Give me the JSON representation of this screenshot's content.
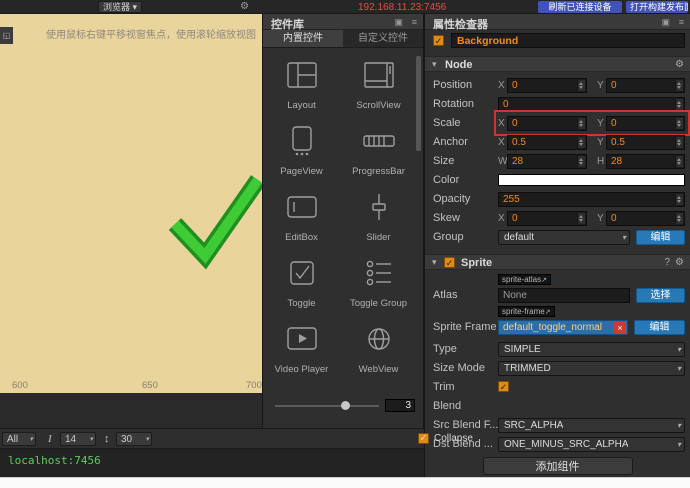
{
  "colors": {
    "accent_orange": "#f78a1d",
    "button_blue": "#2779b8",
    "annotation_red": "#d0342c",
    "check_green": "#3ecb35",
    "console_green": "#58d058",
    "url_red": "#e0513f"
  },
  "icons": {
    "gear": "⚙",
    "menu": "≡",
    "dock": "▣",
    "caret": "▾",
    "check": "✓",
    "close": "×",
    "help": "?",
    "font_size": "I",
    "line_height": "↕",
    "corner": "◱",
    "goto": "↗"
  },
  "toolbar": {
    "device_dropdown": "浏览器",
    "url": "192.168.11.23:7456",
    "refresh_button": "刷新已连接设备",
    "build_button": "打开构建发布面板"
  },
  "scene": {
    "hint": "使用鼠标右键平移视窗焦点，使用滚轮缩放视图",
    "ruler": [
      "600",
      "650",
      "700"
    ]
  },
  "widgets": {
    "title": "控件库",
    "tabs": [
      {
        "label": "内置控件"
      },
      {
        "label": "自定义控件"
      }
    ],
    "items": [
      {
        "label": "Layout"
      },
      {
        "label": "ScrollView"
      },
      {
        "label": "PageView"
      },
      {
        "label": "ProgressBar"
      },
      {
        "label": "EditBox"
      },
      {
        "label": "Slider"
      },
      {
        "label": "Toggle"
      },
      {
        "label": "Toggle Group"
      },
      {
        "label": "Video Player"
      },
      {
        "label": "WebView"
      }
    ],
    "zoom_value": "3"
  },
  "inspector": {
    "title": "属性检查器",
    "node_name": "Background",
    "node_section": "Node",
    "sprite_section": "Sprite",
    "axis": {
      "x": "X",
      "y": "Y",
      "w": "W",
      "h": "H"
    },
    "position": {
      "label": "Position",
      "x": "0",
      "y": "0"
    },
    "rotation": {
      "label": "Rotation",
      "value": "0"
    },
    "scale": {
      "label": "Scale",
      "x": "0",
      "y": "0"
    },
    "anchor": {
      "label": "Anchor",
      "x": "0.5",
      "y": "0.5"
    },
    "size": {
      "label": "Size",
      "w": "28",
      "h": "28"
    },
    "color": {
      "label": "Color"
    },
    "opacity": {
      "label": "Opacity",
      "value": "255"
    },
    "skew": {
      "label": "Skew",
      "x": "0",
      "y": "0"
    },
    "group": {
      "label": "Group",
      "value": "default",
      "edit": "编辑"
    },
    "atlas": {
      "label": "Atlas",
      "tag": "sprite-atlas",
      "value": "None",
      "button": "选择"
    },
    "sprite_frame": {
      "label": "Sprite Frame",
      "tag": "sprite-frame",
      "value": "default_toggle_normal",
      "button": "编辑"
    },
    "type": {
      "label": "Type",
      "value": "SIMPLE"
    },
    "size_mode": {
      "label": "Size Mode",
      "value": "TRIMMED"
    },
    "trim": {
      "label": "Trim"
    },
    "blend": {
      "label": "Blend"
    },
    "src_blend": {
      "label": "Src Blend F...",
      "value": "SRC_ALPHA"
    },
    "dst_blend": {
      "label": "Dst Blend ...",
      "value": "ONE_MINUS_SRC_ALPHA"
    },
    "add_component": "添加组件"
  },
  "console": {
    "filter": "All",
    "font_size": "14",
    "line_height": "30",
    "collapse": "Collapse",
    "log": "localhost:7456"
  }
}
